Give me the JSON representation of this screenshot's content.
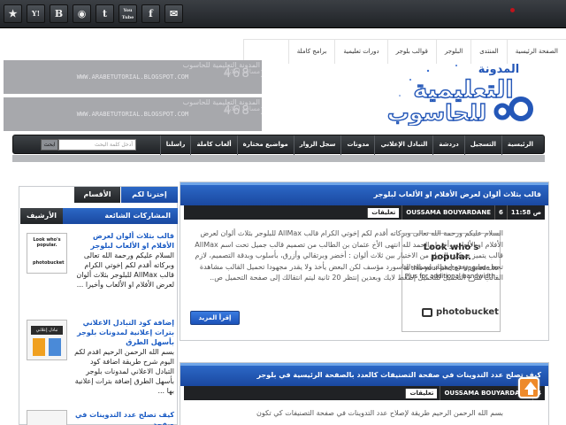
{
  "social": [
    {
      "name": "star-icon",
      "glyph": "★"
    },
    {
      "name": "yahoo-icon",
      "glyph": "Y!"
    },
    {
      "name": "blogger-icon",
      "glyph": "B"
    },
    {
      "name": "rss-icon",
      "glyph": "◉"
    },
    {
      "name": "twitter-icon",
      "glyph": "t"
    },
    {
      "name": "youtube-icon",
      "glyph": "You Tube"
    },
    {
      "name": "facebook-icon",
      "glyph": "f"
    },
    {
      "name": "mail-icon",
      "glyph": "✉"
    }
  ],
  "top_links": [
    "الصفحة الرئيسية",
    "المنتدى",
    "البلوجر",
    "قوالب بلوجر",
    "دورات تعليمية",
    "برامج كاملة"
  ],
  "logo": {
    "line1": "المدونة",
    "line2": "التعليمية",
    "line3": "للحاسوب"
  },
  "ads": [
    {
      "title": "المدونة التعليمية للحاسوب",
      "url": "WWW.ARABETUTORIAL.BLOGSPOT.COM",
      "size": "468 x 60",
      "label": "مساحة اعلانية"
    },
    {
      "title": "المدونة التعليمية للحاسوب",
      "url": "WWW.ARABETUTORIAL.BLOGSPOT.COM",
      "size": "468 x 60",
      "label": "مساحة اعلانية"
    }
  ],
  "nav": [
    "الرئيسية",
    "التسجيل",
    "دردشة",
    "التبادل الإعلاني",
    "مدونات",
    "سجل الزوار",
    "مواضيع مختارة",
    "ألعاب كاملة",
    "راسلنا"
  ],
  "search": {
    "placeholder": "أدخل كلمة البحث",
    "button": "ابحث"
  },
  "posts": [
    {
      "title": "قالب بثلاث ألوان لعرض الأفلام او الألعاب لبلوجر",
      "time": "11:58 ص",
      "comments": "6",
      "author": "OUSSAMA BOUYARDANE",
      "comments_label": "تعليقات",
      "body": "السلام عليكم ورحمة الله تعالى وبركاته أقدم لكم إخوتي الكرام قالب AllMax للبلوجر بثلاث ألوان لعرض الأفلام او الألعاب وأخيرا والحمد لله انتهى الأخ عثمان بن الطالب من تصميم قالب جميل تحت اسم AllMax قالب يتميز بتمكين الزوار من الاختيار بين ثلاث ألوان : أخضر وبرتقالي وأزرق، بأسلوب وبدقة التصميم، لازم تجعل تعليق وضع إيميلك ليصلك الباسورد مؤسف لكن البعض يأخذ ولا يقدر مجهودا تحميل القالب مشاهدة القالب شرح التحميل للتحميل إضغط لايك وبعدين إنتظر 20 ثانية ليتم انتقالك إلى صفحة التحميل ص..",
      "read_more": "إقرأ المزيد",
      "image": {
        "headline": "Look who's popular.",
        "sub": "Is this your photo? Upgrade to Plus for additional bandwidth.",
        "brand": "photobucket"
      }
    },
    {
      "title": "كيف تصلح عدد التدوينات في صفحة التصنيفات كالعدد بالصفحة الرئيسية في بلوجر",
      "comments": "4",
      "author": "OUSSAMA BOUYARDANE",
      "comments_label": "تعليقات",
      "body": "بسم الله الرحمن الرحيم طريقة لإصلاح عدد التدوينات في صفحة التصنيفات كي تكون"
    }
  ],
  "sidebar": {
    "tabs": [
      "إخترنا لكم",
      "الأقسام",
      "الأرشيف"
    ],
    "box_title": "المشاركات الشائعة",
    "items": [
      {
        "link": "قالب بثلاث ألوان لعرض الأفلام او الألعاب لبلوجر",
        "text": "السلام عليكم ورحمة الله تعالى وبركاته أقدم لكم إخوتي الكرام قالب AllMax للبلوجر بثلاث ألوان لعرض الأفلام او الألعاب وأخيرا ..."
      },
      {
        "link": "إضافة كود التبادل الاعلاني بترات إعلانية لمدونات بلوجر بأسهل الطرق",
        "text": "بسم الله الرحمن الرحيم اقدم لكم اليوم شرح طريقة اضافة كود التبادل الاعلاني لمدونات بلوجر بأسهل الطرق إضافة بترات إعلانية بها ..."
      },
      {
        "link": "كيف تصلح عدد التدوينات في صفحة"
      }
    ],
    "thumb2_label": "تبادل إعلاني"
  }
}
